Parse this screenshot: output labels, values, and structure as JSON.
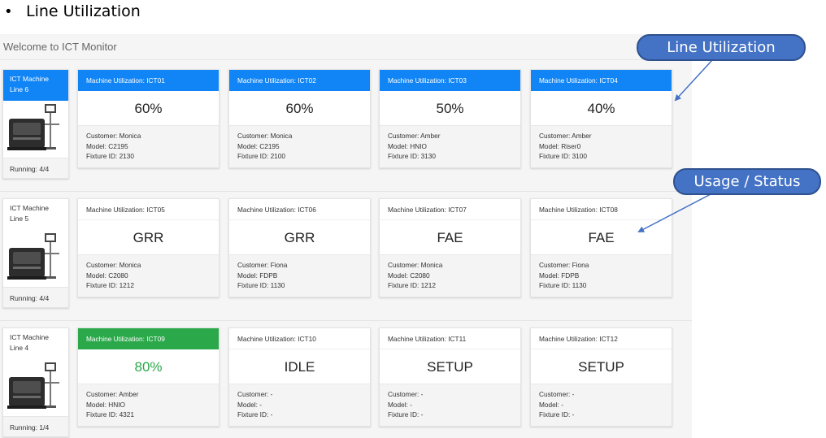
{
  "slide": {
    "bullet": "•",
    "heading": "Line Utilization"
  },
  "app": {
    "title": "Welcome to ICT Monitor",
    "lines": [
      {
        "name_1": "ICT Machine",
        "name_2": "Line 6",
        "running": "Running: 4/4",
        "machines": [
          {
            "header": "Machine Utilization: ICT01",
            "value": "60%",
            "customer": "Customer: Monica",
            "model": "Model: C2195",
            "fixture": "Fixture ID: 2130"
          },
          {
            "header": "Machine Utilization: ICT02",
            "value": "60%",
            "customer": "Customer: Monica",
            "model": "Model: C2195",
            "fixture": "Fixture ID: 2100"
          },
          {
            "header": "Machine Utilization: ICT03",
            "value": "50%",
            "customer": "Customer: Amber",
            "model": "Model: HNIO",
            "fixture": "Fixture ID: 3130"
          },
          {
            "header": "Machine Utilization: ICT04",
            "value": "40%",
            "customer": "Customer: Amber",
            "model": "Model: Riser0",
            "fixture": "Fixture ID: 3100"
          }
        ]
      },
      {
        "name_1": "ICT Machine",
        "name_2": "Line 5",
        "running": "Running: 4/4",
        "machines": [
          {
            "header": "Machine Utilization: ICT05",
            "value": "GRR",
            "customer": "Customer: Monica",
            "model": "Model: C2080",
            "fixture": "Fixture ID: 1212"
          },
          {
            "header": "Machine Utilization: ICT06",
            "value": "GRR",
            "customer": "Customer: Fiona",
            "model": "Model: FDPB",
            "fixture": "Fixture ID: 1130"
          },
          {
            "header": "Machine Utilization: ICT07",
            "value": "FAE",
            "customer": "Customer: Monica",
            "model": "Model: C2080",
            "fixture": "Fixture ID: 1212"
          },
          {
            "header": "Machine Utilization: ICT08",
            "value": "FAE",
            "customer": "Customer: Fiona",
            "model": "Model: FDPB",
            "fixture": "Fixture ID: 1130"
          }
        ]
      },
      {
        "name_1": "ICT Machine",
        "name_2": "Line 4",
        "running": "Running: 1/4",
        "machines": [
          {
            "header": "Machine Utilization: ICT09",
            "value": "80%",
            "customer": "Customer: Amber",
            "model": "Model: HNIO",
            "fixture": "Fixture ID: 4321"
          },
          {
            "header": "Machine Utilization: ICT10",
            "value": "IDLE",
            "customer": "Customer: -",
            "model": "Model: -",
            "fixture": "Fixture ID: -"
          },
          {
            "header": "Machine Utilization: ICT11",
            "value": "SETUP",
            "customer": "Customer: -",
            "model": "Model: -",
            "fixture": "Fixture ID: -"
          },
          {
            "header": "Machine Utilization: ICT12",
            "value": "SETUP",
            "customer": "Customer: -",
            "model": "Model: -",
            "fixture": "Fixture ID: -"
          }
        ]
      }
    ]
  },
  "callouts": {
    "utilization": "Line Utilization",
    "status": "Usage / Status"
  },
  "colors": {
    "active_blue": "#1185f5",
    "running_green": "#2aa84a",
    "callout_fill": "#4472c4"
  }
}
